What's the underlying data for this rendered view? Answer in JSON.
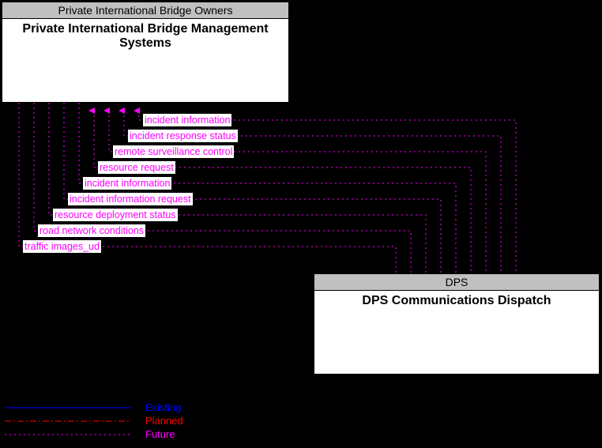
{
  "nodes": {
    "top": {
      "header": "Private International Bridge Owners",
      "title": "Private International Bridge Management Systems"
    },
    "bottom": {
      "header": "DPS",
      "title": "DPS Communications Dispatch"
    }
  },
  "flows": [
    {
      "label": "incident information"
    },
    {
      "label": "incident response status"
    },
    {
      "label": "remote surveillance control"
    },
    {
      "label": "resource request"
    },
    {
      "label": "incident information"
    },
    {
      "label": "incident information request"
    },
    {
      "label": "resource deployment status"
    },
    {
      "label": "road network conditions"
    },
    {
      "label": "traffic images_ud"
    }
  ],
  "legend": {
    "existing": {
      "label": "Existing",
      "color": "#0000ff"
    },
    "planned": {
      "label": "Planned",
      "color": "#ff0000"
    },
    "future": {
      "label": "Future",
      "color": "#ff00ff"
    }
  }
}
